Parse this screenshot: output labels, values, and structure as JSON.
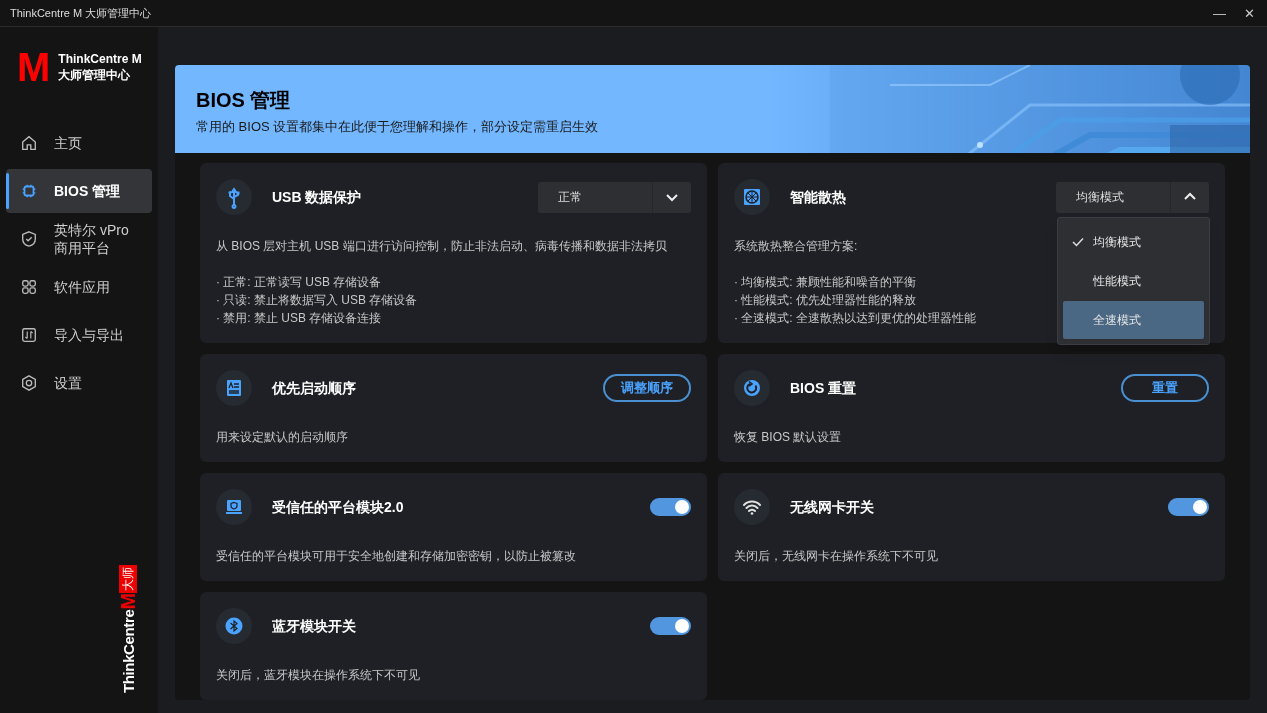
{
  "window": {
    "title": "ThinkCentre M 大师管理中心",
    "controls": [
      "—",
      "✕"
    ]
  },
  "sidebar": {
    "logo_letter": "M",
    "brand_lines": [
      "ThinkCentre M",
      "大师管理中心"
    ],
    "items": [
      {
        "label": "主页",
        "selected": false
      },
      {
        "label": "BIOS 管理",
        "selected": true
      },
      {
        "label": "英特尔 vPro 商用平台",
        "selected": false
      },
      {
        "label": "软件应用",
        "selected": false
      },
      {
        "label": "导入与导出",
        "selected": false
      },
      {
        "label": "设置",
        "selected": false
      }
    ],
    "vertical_brand": {
      "name": "ThinkCentre",
      "mark": "M",
      "tag": "大师"
    }
  },
  "header": {
    "title": "BIOS 管理",
    "subtitle": "常用的 BIOS 设置都集中在此便于您理解和操作，部分设定需重启生效"
  },
  "cards": [
    {
      "kind": "select",
      "title": "USB 数据保护",
      "description": "从 BIOS 层对主机 USB 端口进行访问控制，防止非法启动、病毒传播和数据非法拷贝",
      "details": [
        "· 正常: 正常读写 USB 存储设备",
        "· 只读: 禁止将数据写入 USB 存储设备",
        "· 禁用: 禁止 USB 存储设备连接"
      ],
      "value": "正常",
      "expanded": false
    },
    {
      "kind": "select",
      "title": "智能散热",
      "description": "系统散热整合管理方案:",
      "details": [
        "· 均衡模式: 兼顾性能和噪音的平衡",
        "· 性能模式: 优先处理器性能的释放",
        "· 全速模式: 全速散热以达到更优的处理器性能"
      ],
      "value": "均衡模式",
      "expanded": true,
      "options": [
        {
          "label": "均衡模式",
          "selected": true,
          "highlighted": false
        },
        {
          "label": "性能模式",
          "selected": false,
          "highlighted": false
        },
        {
          "label": "全速模式",
          "selected": false,
          "highlighted": true
        }
      ]
    },
    {
      "kind": "button",
      "title": "优先启动顺序",
      "description": "用来设定默认的启动顺序",
      "button": "调整顺序"
    },
    {
      "kind": "button",
      "title": "BIOS 重置",
      "description": "恢复 BIOS 默认设置",
      "button": "重置"
    },
    {
      "kind": "toggle",
      "title": "受信任的平台模块2.0",
      "description": "受信任的平台模块可用于安全地创建和存储加密密钥，以防止被篡改",
      "on": true
    },
    {
      "kind": "toggle",
      "title": "无线网卡开关",
      "description": "关闭后，无线网卡在操作系统下不可见",
      "on": true
    },
    {
      "kind": "toggle",
      "title": "蓝牙模块开关",
      "description": "关闭后，蓝牙模块在操作系统下不可见",
      "on": true
    }
  ]
}
